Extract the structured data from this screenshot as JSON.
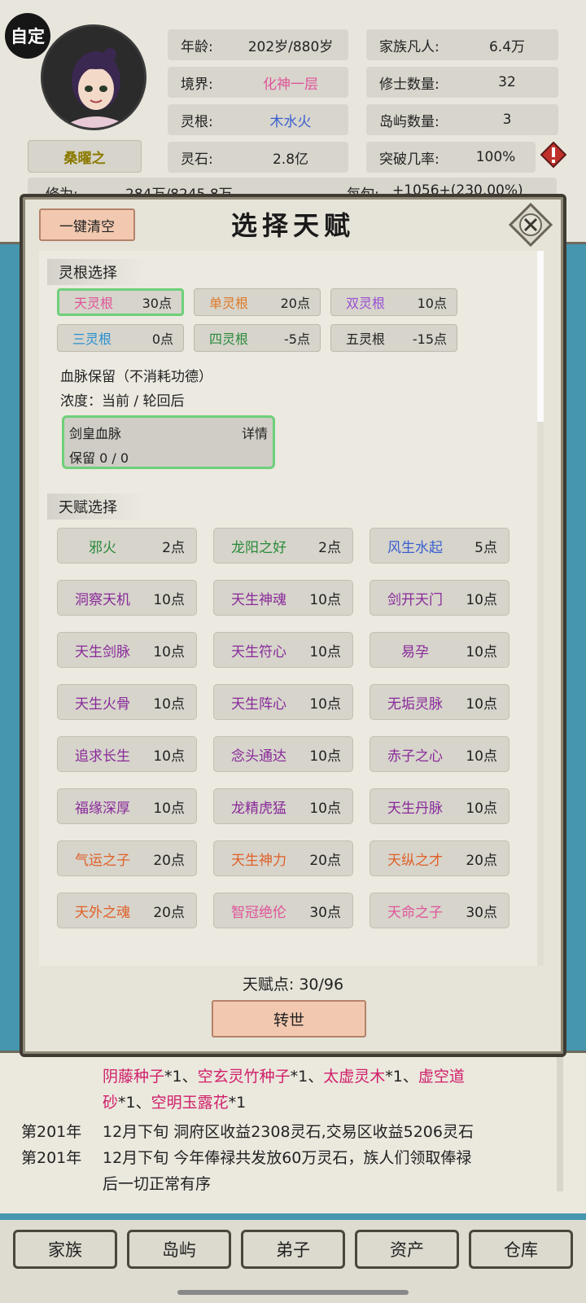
{
  "header": {
    "custom_badge": "自定",
    "character_name": "桑曜之",
    "stats": [
      {
        "label": "年龄:",
        "value": "202岁/880岁",
        "color": "#222222"
      },
      {
        "label": "家族凡人:",
        "value": "6.4万",
        "color": "#222222"
      },
      {
        "label": "境界:",
        "value": "化神一层",
        "color": "#e0549a"
      },
      {
        "label": "修士数量:",
        "value": "32",
        "color": "#222222"
      },
      {
        "label": "灵根:",
        "value": "木水火",
        "color": "#3a5fd0"
      },
      {
        "label": "岛屿数量:",
        "value": "3",
        "color": "#222222"
      },
      {
        "label": "灵石:",
        "value": "2.8亿",
        "color": "#222222"
      },
      {
        "label": "突破几率:",
        "value": "100%",
        "color": "#222222"
      }
    ],
    "cultivation_label": "修为:",
    "cultivation_value": "284万/8245.8万",
    "per_tick_label": "每旬:",
    "per_tick_value": "+1056+(230.00%)",
    "warning_icon": "warning-diamond-icon"
  },
  "modal": {
    "clear_button": "一键清空",
    "title": "选择天赋",
    "close_icon": "close-x-icon",
    "spirit_root_header": "灵根选择",
    "spirit_roots": [
      {
        "name": "天灵根",
        "points": "30点",
        "color": "#e0549a",
        "selected": true
      },
      {
        "name": "单灵根",
        "points": "20点",
        "color": "#e07a2a",
        "selected": false
      },
      {
        "name": "双灵根",
        "points": "10点",
        "color": "#9a4fd0",
        "selected": false
      },
      {
        "name": "三灵根",
        "points": "0点",
        "color": "#2a8fd0",
        "selected": false
      },
      {
        "name": "四灵根",
        "points": "-5点",
        "color": "#2a8a3a",
        "selected": false
      },
      {
        "name": "五灵根",
        "points": "-15点",
        "color": "#222222",
        "selected": false
      }
    ],
    "bloodline_note": "血脉保留（不消耗功德）",
    "concentration": "浓度：当前 / 轮回后",
    "bloodline": {
      "name": "剑皇血脉",
      "detail": "详情",
      "retain": "保留 0 / 0"
    },
    "talent_header": "天赋选择",
    "talents": [
      {
        "name": "邪火",
        "points": "2点",
        "color": "#2a8a3a"
      },
      {
        "name": "龙阳之好",
        "points": "2点",
        "color": "#2a8a3a"
      },
      {
        "name": "风生水起",
        "points": "5点",
        "color": "#3a5fd0"
      },
      {
        "name": "洞察天机",
        "points": "10点",
        "color": "#8a2a9a"
      },
      {
        "name": "天生神魂",
        "points": "10点",
        "color": "#8a2a9a"
      },
      {
        "name": "剑开天门",
        "points": "10点",
        "color": "#8a2a9a"
      },
      {
        "name": "天生剑脉",
        "points": "10点",
        "color": "#8a2a9a"
      },
      {
        "name": "天生符心",
        "points": "10点",
        "color": "#8a2a9a"
      },
      {
        "name": "易孕",
        "points": "10点",
        "color": "#8a2a9a"
      },
      {
        "name": "天生火骨",
        "points": "10点",
        "color": "#8a2a9a"
      },
      {
        "name": "天生阵心",
        "points": "10点",
        "color": "#8a2a9a"
      },
      {
        "name": "无垢灵脉",
        "points": "10点",
        "color": "#8a2a9a"
      },
      {
        "name": "追求长生",
        "points": "10点",
        "color": "#8a2a9a"
      },
      {
        "name": "念头通达",
        "points": "10点",
        "color": "#8a2a9a"
      },
      {
        "name": "赤子之心",
        "points": "10点",
        "color": "#8a2a9a"
      },
      {
        "name": "福缘深厚",
        "points": "10点",
        "color": "#8a2a9a"
      },
      {
        "name": "龙精虎猛",
        "points": "10点",
        "color": "#8a2a9a"
      },
      {
        "name": "天生丹脉",
        "points": "10点",
        "color": "#8a2a9a"
      },
      {
        "name": "气运之子",
        "points": "20点",
        "color": "#e0602a"
      },
      {
        "name": "天生神力",
        "points": "20点",
        "color": "#e0602a"
      },
      {
        "name": "天纵之才",
        "points": "20点",
        "color": "#e0602a"
      },
      {
        "name": "天外之魂",
        "points": "20点",
        "color": "#e0602a"
      },
      {
        "name": "智冠绝伦",
        "points": "30点",
        "color": "#e0549a"
      },
      {
        "name": "天命之子",
        "points": "30点",
        "color": "#e0549a"
      }
    ],
    "talent_points_label": "天赋点:",
    "talent_points_value": "30/96",
    "reborn_button": "转世"
  },
  "log": {
    "line1_items": [
      "阴藤种子",
      "*1、",
      "空玄灵竹种子",
      "*1、",
      "太虚灵木",
      "*1、",
      "虚空道"
    ],
    "line2_items": [
      "砂",
      "*1、",
      "空明玉露花",
      "*1"
    ],
    "entries": [
      {
        "year": "第201年",
        "text": "12月下旬 洞府区收益2308灵石,交易区收益5206灵石"
      },
      {
        "year": "第201年",
        "text": "12月下旬 今年俸禄共发放60万灵石，族人们领取俸禄"
      }
    ],
    "continuation": "后一切正常有序",
    "highlight_color": "#d0206a"
  },
  "nav": [
    "家族",
    "岛屿",
    "弟子",
    "资产",
    "仓库"
  ]
}
